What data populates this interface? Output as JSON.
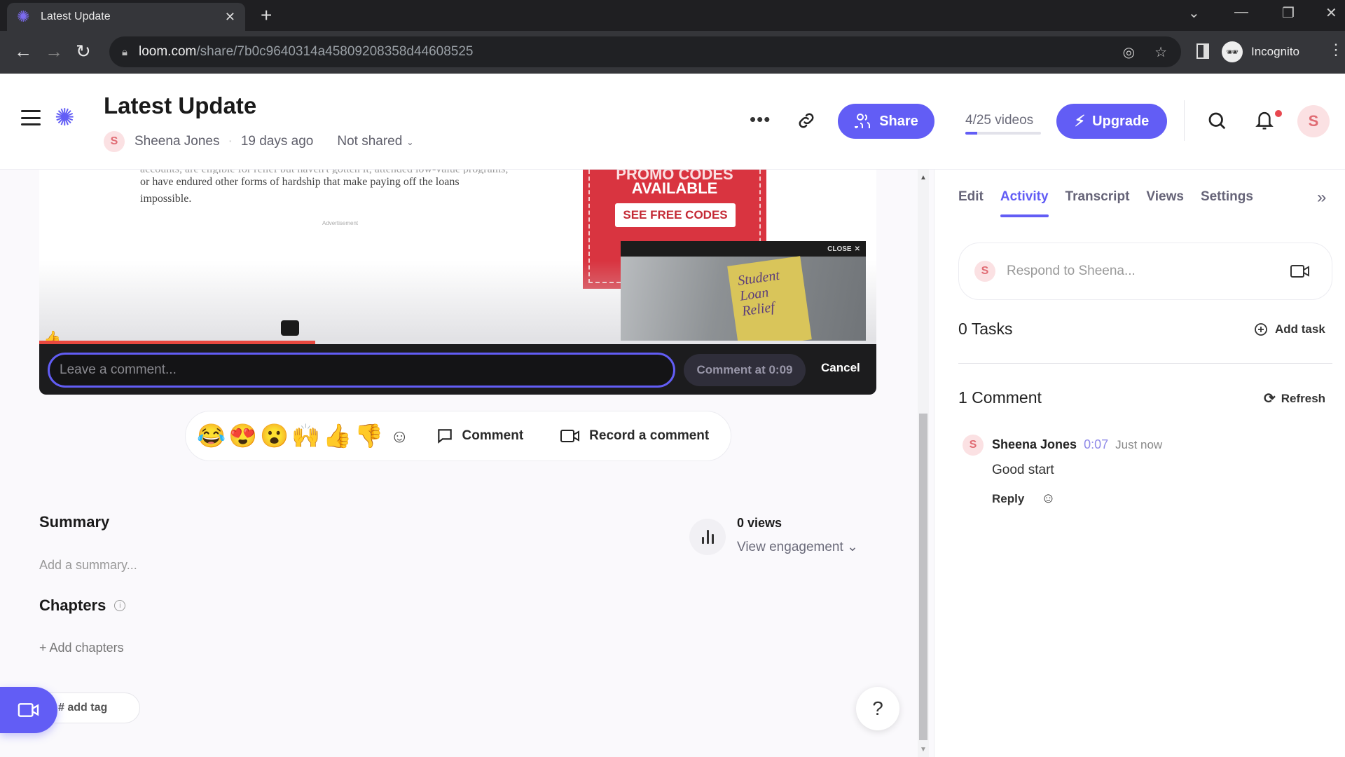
{
  "browser": {
    "tab_title": "Latest Update",
    "url_host": "loom.com",
    "url_path": "/share/7b0c9640314a45809208358d44608525",
    "profile_label": "Incognito"
  },
  "header": {
    "title": "Latest Update",
    "author": "Sheena Jones",
    "author_initial": "S",
    "age": "19 days ago",
    "sharing": "Not shared",
    "share_label": "Share",
    "quota_text": "4/25 videos",
    "quota_fraction": 0.16,
    "upgrade_label": "Upgrade",
    "user_initial": "S",
    "has_notification": true
  },
  "video": {
    "article_lines": [
      "accounts, are eligible for relief but haven't gotten it, attended low-value programs,",
      "or have endured other forms of hardship that make paying off the loans",
      "impossible."
    ],
    "ad_label": "Advertisement",
    "promo_line1": "PROMO CODES",
    "promo_line2": "AVAILABLE",
    "promo_button": "SEE FREE CODES",
    "pip_close": "CLOSE",
    "pip_sign": "Student Loan Relief",
    "progress_fraction": 0.33,
    "comment_placeholder": "Leave a comment...",
    "comment_value": "",
    "comment_at_label": "Comment at 0:09",
    "cancel_label": "Cancel"
  },
  "reactions": {
    "emojis": [
      "😂",
      "😍",
      "😮",
      "🙌",
      "👍",
      "👎"
    ],
    "comment_label": "Comment",
    "record_label": "Record a comment"
  },
  "summary": {
    "heading": "Summary",
    "placeholder": "Add a summary...",
    "views": "0 views",
    "engagement_label": "View engagement"
  },
  "chapters": {
    "heading": "Chapters",
    "add_label": "+ Add chapters"
  },
  "tags": {
    "add_label": "# add tag"
  },
  "help_label": "?",
  "panel": {
    "tabs": [
      {
        "label": "Edit",
        "active": false
      },
      {
        "label": "Activity",
        "active": true
      },
      {
        "label": "Transcript",
        "active": false
      },
      {
        "label": "Views",
        "active": false
      },
      {
        "label": "Settings",
        "active": false
      }
    ],
    "respond_placeholder": "Respond to Sheena...",
    "respond_initial": "S",
    "tasks_heading": "0 Tasks",
    "add_task_label": "Add task",
    "comments_heading": "1 Comment",
    "refresh_label": "Refresh",
    "comments": [
      {
        "initial": "S",
        "author": "Sheena Jones",
        "timestamp": "0:07",
        "when": "Just now",
        "text": "Good start",
        "reply_label": "Reply"
      }
    ]
  },
  "colors": {
    "brand": "#625df5",
    "progress": "#e8483f",
    "notification": "#e8474f"
  }
}
